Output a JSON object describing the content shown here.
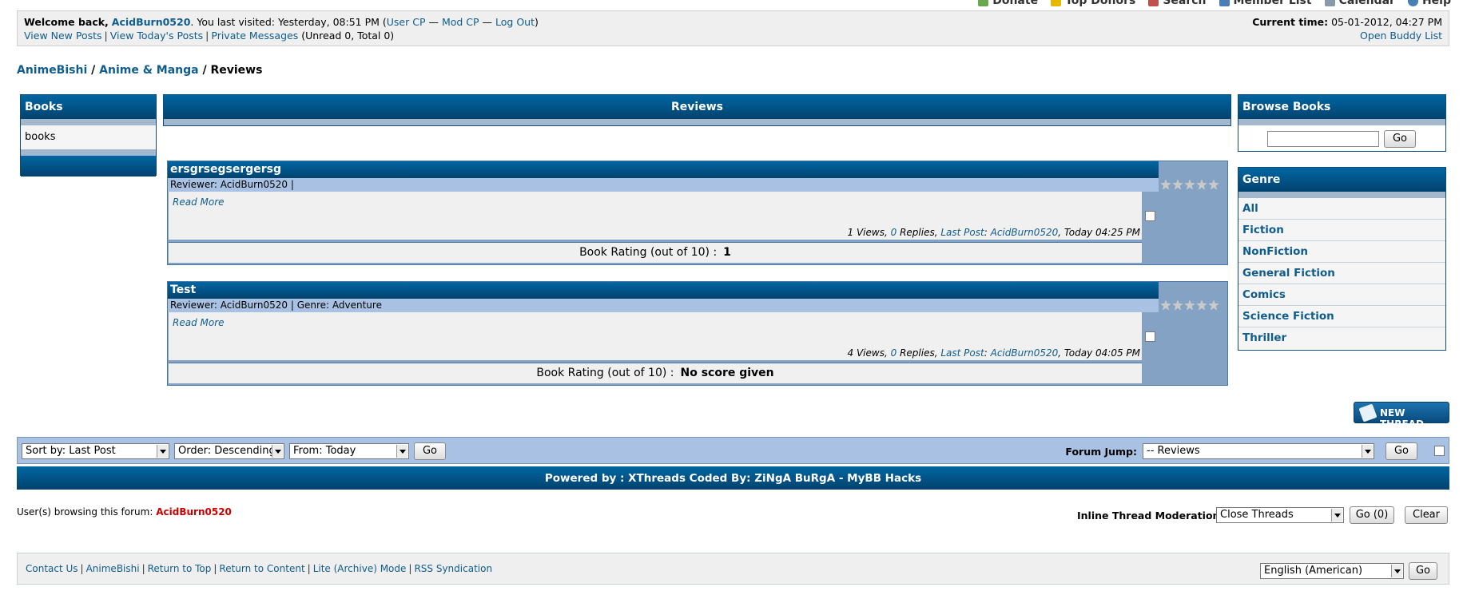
{
  "top_menu": {
    "items": [
      {
        "label": "Donate",
        "icon": "donate-icon",
        "color": "#6aa84f"
      },
      {
        "label": "Top Donors",
        "icon": "donors-icon",
        "color": "#e6b800"
      },
      {
        "label": "Search",
        "icon": "search-icon",
        "color": "#c05050"
      },
      {
        "label": "Member List",
        "icon": "member-list-icon",
        "color": "#4a7fb5"
      },
      {
        "label": "Calendar",
        "icon": "calendar-icon",
        "color": "#8899aa"
      },
      {
        "label": "Help",
        "icon": "help-icon",
        "color": "#4a7fb5"
      }
    ]
  },
  "welcome": {
    "prefix": "Welcome back,",
    "username": "AcidBurn0520",
    "visited": ". You last visited: Yesterday, 08:51 PM (",
    "user_cp": "User CP",
    "dash1": " — ",
    "mod_cp": "Mod CP",
    "dash2": " — ",
    "logout": "Log Out",
    "close": ")",
    "view_new": "View New Posts",
    "view_today": "View Today's Posts",
    "pm": "Private Messages",
    "pm_counts": "(Unread 0, Total 0)",
    "current_time_label": "Current time:",
    "current_time": "05-01-2012, 04:27 PM",
    "buddy": "Open Buddy List"
  },
  "breadcrumb": {
    "home": "AnimeBishi",
    "sep1": " / ",
    "section": "Anime & Manga",
    "sep2": " / ",
    "current": "Reviews"
  },
  "books_box": {
    "title": "Books",
    "item": "books"
  },
  "reviews_box": {
    "title": "Reviews"
  },
  "reviews": [
    {
      "title": "ersgrsegsergersg",
      "meta": "Reviewer: AcidBurn0520 |",
      "read_more": "Read More",
      "views": "1 Views,",
      "replies_count": "0",
      "replies_label": "Replies,",
      "last_post_label": "Last Post",
      "colon": ":",
      "last_post_user": "AcidBurn0520",
      "last_post_time": ", Today 04:25 PM",
      "rating_label": "Book Rating (out of 10) :",
      "rating_value": "1"
    },
    {
      "title": "Test",
      "meta": "Reviewer: AcidBurn0520 | Genre: Adventure",
      "read_more": "Read More",
      "views": "4 Views,",
      "replies_count": "0",
      "replies_label": "Replies,",
      "last_post_label": "Last Post",
      "colon": ":",
      "last_post_user": "AcidBurn0520",
      "last_post_time": ", Today 04:05 PM",
      "rating_label": "Book Rating (out of 10) :",
      "rating_value": "No score given"
    }
  ],
  "browse_box": {
    "title": "Browse Books",
    "go": "Go"
  },
  "genre_box": {
    "title": "Genre",
    "items": [
      "All",
      "Fiction",
      "NonFiction",
      "General Fiction",
      "Comics",
      "Science Fiction",
      "Thriller"
    ]
  },
  "new_thread": "NEW THREAD",
  "sort_bar": {
    "sort_by": "Sort by: Last Post",
    "order": "Order: Descending",
    "from": "From: Today",
    "go": "Go",
    "forum_jump_label": "Forum Jump:",
    "forum_jump_value": "-- Reviews",
    "forum_go": "Go"
  },
  "powered": "Powered by : XThreads Coded By: ZiNgA BuRgA - MyBB Hacks",
  "browsing": {
    "label": "User(s) browsing this forum:",
    "user": "AcidBurn0520"
  },
  "inline_mod": {
    "label": "Inline Thread Moderation:",
    "value": "Close Threads",
    "go": "Go (0)",
    "clear": "Clear"
  },
  "footer": {
    "links": [
      "Contact Us",
      "AnimeBishi",
      "Return to Top",
      "Return to Content",
      "Lite (Archive) Mode",
      "RSS Syndication"
    ],
    "language": "English (American)",
    "go": "Go"
  }
}
